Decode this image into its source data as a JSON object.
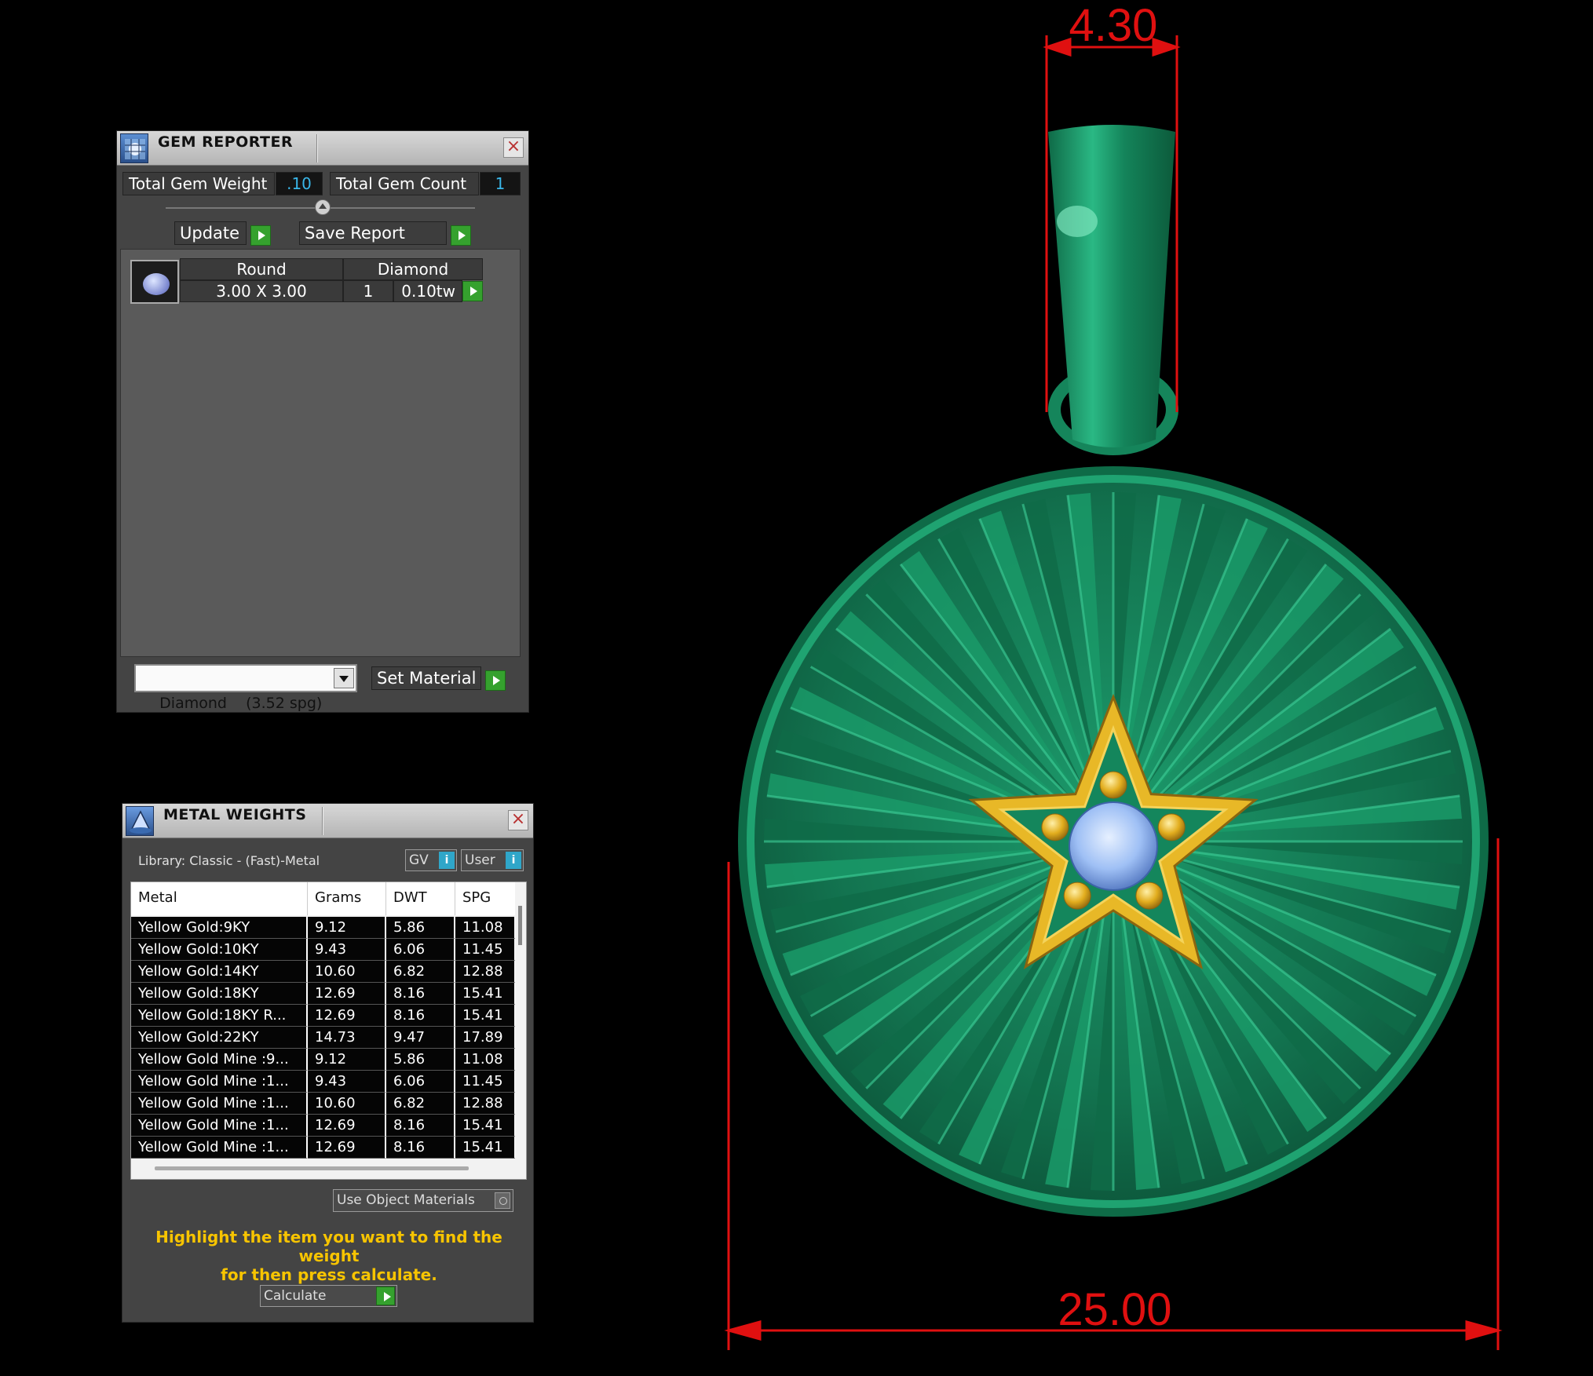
{
  "gem_reporter": {
    "title": "GEM REPORTER",
    "total_weight_label": "Total Gem Weight",
    "total_weight_value": ".10",
    "total_count_label": "Total Gem Count",
    "total_count_value": "1",
    "update_label": "Update",
    "save_report_label": "Save Report",
    "gem": {
      "shape": "Round",
      "material": "Diamond",
      "size": "3.00 X 3.00",
      "count": "1",
      "weight": "0.10tw"
    },
    "material_select": "Diamond    (3.52 spg)",
    "set_material_label": "Set Material"
  },
  "metal_weights": {
    "title": "METAL WEIGHTS",
    "library": "Library: Classic - (Fast)-Metal",
    "gv_label": "GV",
    "user_label": "User",
    "columns": [
      "Metal",
      "Grams",
      "DWT",
      "SPG"
    ],
    "rows": [
      [
        "Yellow Gold:9KY",
        "9.12",
        "5.86",
        "11.08"
      ],
      [
        "Yellow Gold:10KY",
        "9.43",
        "6.06",
        "11.45"
      ],
      [
        "Yellow Gold:14KY",
        "10.60",
        "6.82",
        "12.88"
      ],
      [
        "Yellow Gold:18KY",
        "12.69",
        "8.16",
        "15.41"
      ],
      [
        "Yellow Gold:18KY R...",
        "12.69",
        "8.16",
        "15.41"
      ],
      [
        "Yellow Gold:22KY",
        "14.73",
        "9.47",
        "17.89"
      ],
      [
        "Yellow Gold Mine :9...",
        "9.12",
        "5.86",
        "11.08"
      ],
      [
        "Yellow Gold Mine :1...",
        "9.43",
        "6.06",
        "11.45"
      ],
      [
        "Yellow Gold Mine :1...",
        "10.60",
        "6.82",
        "12.88"
      ],
      [
        "Yellow Gold Mine :1...",
        "12.69",
        "8.16",
        "15.41"
      ],
      [
        "Yellow Gold Mine :1...",
        "12.69",
        "8.16",
        "15.41"
      ]
    ],
    "use_object_materials": "Use Object Materials",
    "hint_line1": "Highlight the item you want to find the weight",
    "hint_line2": "for then press calculate.",
    "calculate_label": "Calculate"
  },
  "viewport": {
    "bail_width": "4.30",
    "pendant_diameter": "25.00",
    "colors": {
      "metal": "#1f8a5e",
      "star": "#e8b827",
      "gem": "#a9c9ff",
      "dimension": "#e01010"
    }
  }
}
